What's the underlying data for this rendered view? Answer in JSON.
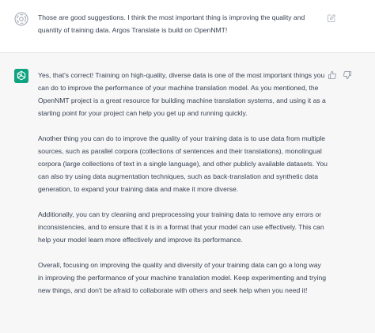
{
  "conversation": {
    "user_message": {
      "text": "Those are good suggestions. I think the most important thing is improving the quality and quantity of training data. Argos Translate is build on OpenNMT!",
      "avatar_icon": "user-avatar-icon",
      "edit_icon": "edit-icon"
    },
    "assistant_message": {
      "paragraphs": [
        "Yes, that's correct! Training on high-quality, diverse data is one of the most important things you can do to improve the performance of your machine translation model. As you mentioned, the OpenNMT project is a great resource for building machine translation systems, and using it as a starting point for your project can help you get up and running quickly.",
        "Another thing you can do to improve the quality of your training data is to use data from multiple sources, such as parallel corpora (collections of sentences and their translations), monolingual corpora (large collections of text in a single language), and other publicly available datasets. You can also try using data augmentation techniques, such as back-translation and synthetic data generation, to expand your training data and make it more diverse.",
        "Additionally, you can try cleaning and preprocessing your training data to remove any errors or inconsistencies, and to ensure that it is in a format that your model can use effectively. This can help your model learn more effectively and improve its performance.",
        "Overall, focusing on improving the quality and diversity of your training data can go a long way in improving the performance of your machine translation model. Keep experimenting and trying new things, and don't be afraid to collaborate with others and seek help when you need it!"
      ],
      "avatar_icon": "chatgpt-logo-icon",
      "feedback_icons": [
        "thumbs-up-icon",
        "thumbs-down-icon"
      ]
    }
  },
  "colors": {
    "assistant_background": "#f7f7f8",
    "user_background": "#ffffff",
    "brand_green": "#10a37f",
    "text": "#374151",
    "icon_gray": "#9ca3af"
  }
}
